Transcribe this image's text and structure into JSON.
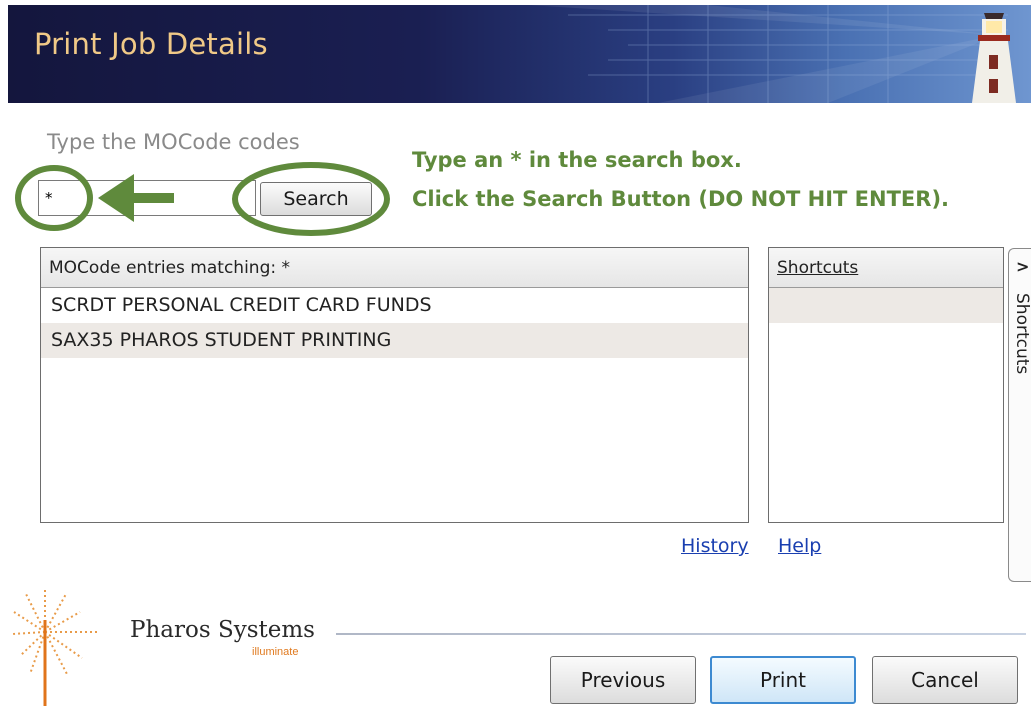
{
  "window": {
    "title": "Print Job Details"
  },
  "search": {
    "prompt": "Type the MOCode codes",
    "value": "*",
    "button_label": "Search"
  },
  "annotation": {
    "line1": "Type an * in the search box.",
    "line2": "Click the Search Button (DO NOT HIT ENTER).",
    "color": "#5f8a3c"
  },
  "results": {
    "header": "MOCode entries matching: *",
    "rows": [
      "SCRDT PERSONAL CREDIT CARD FUNDS",
      "SAX35  PHAROS STUDENT PRINTING"
    ]
  },
  "shortcuts": {
    "header": "Shortcuts",
    "tab_label": "Shortcuts",
    "tab_chevron": ">"
  },
  "links": {
    "history": "History",
    "help": "Help"
  },
  "footer": {
    "brand": "Pharos Systems",
    "tagline": "illuminate",
    "previous_label": "Previous",
    "print_label": "Print",
    "cancel_label": "Cancel"
  },
  "colors": {
    "title_text": "#f0c987",
    "accent_green": "#5f8a3c",
    "link_blue": "#1a3fb0",
    "focus_blue": "#3d8ad1"
  }
}
